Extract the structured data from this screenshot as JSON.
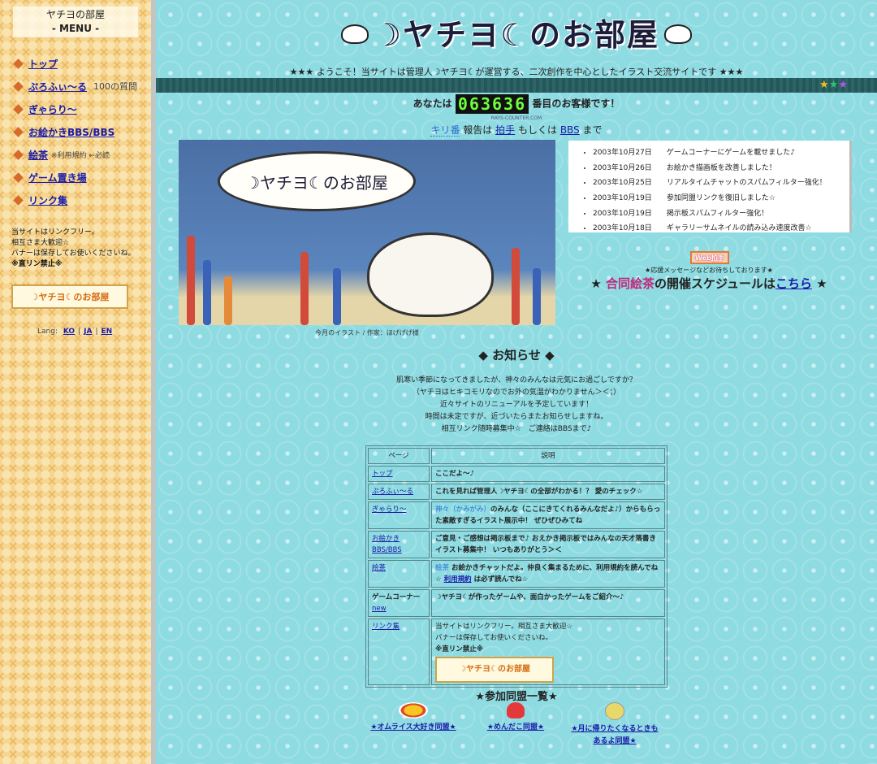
{
  "sidebar": {
    "site_name": "ヤチヨの部屋",
    "menu_label": "- MENU -",
    "items": [
      {
        "label": "トップ",
        "note": ""
      },
      {
        "label": "ぷろふぃ〜る",
        "note": "100の質問"
      },
      {
        "label": "ぎゃらり〜",
        "note": ""
      },
      {
        "label": "お絵かきBBS/BBS",
        "note": ""
      },
      {
        "label": "絵茶",
        "note": "※利用規約 ←必読"
      },
      {
        "label": "ゲーム置き場",
        "note": ""
      },
      {
        "label": "リンク集",
        "note": ""
      }
    ],
    "info_lines": [
      "当サイトはリンクフリー。",
      "相互さま大歓迎☆",
      "バナーは保存してお使いくださいね。",
      "※直リン禁止※"
    ],
    "banner_text": "☽ヤチヨ☾のお部屋",
    "lang_label": "Lang:",
    "lang_options": [
      "KO",
      "JA",
      "EN"
    ]
  },
  "header": {
    "title": "☽ヤチヨ☾のお部屋",
    "welcome": "★★★ ようこそ！当サイトは管理人☽ヤチヨ☾が運営する、二次創作を中心としたイラスト交流サイトです ★★★",
    "stars": "★★★"
  },
  "counter": {
    "prefix": "あなたは",
    "value": "063636",
    "suffix": "番目のお客様です！",
    "caption": "RAYS-COUNTER.COM",
    "kiriban": "キリ番",
    "report_text": "報告は",
    "link1": "拍手",
    "or_text": "もしくは",
    "link2": "BBS",
    "until": "まで"
  },
  "illustration": {
    "bubble_text": "☽ヤチヨ☾のお部屋",
    "caption": "今月のイラスト / 作家：ほげげげ様"
  },
  "news": [
    {
      "date": "2003年10月27日",
      "text": "ゲームコーナーにゲームを載せました♪"
    },
    {
      "date": "2003年10月26日",
      "text": "お絵かき描画板を改善しました！"
    },
    {
      "date": "2003年10月25日",
      "text": "リアルタイムチャットのスパムフィルター強化！"
    },
    {
      "date": "2003年10月19日",
      "text": "参加同盟リンクを復旧しました☆"
    },
    {
      "date": "2003年10月19日",
      "text": "掲示板スパムフィルター強化！"
    },
    {
      "date": "2003年10月18日",
      "text": "ギャラリーサムネイルの読み込み速度改善☆"
    }
  ],
  "web_clap": {
    "button": "Web拍手",
    "message": "★応援メッセージなどお待ちしております★"
  },
  "schedule": {
    "prefix": "★ ",
    "highlight": "合同絵茶",
    "middle": "の開催スケジュールは",
    "link": "こちら",
    "suffix": " ★"
  },
  "notice": {
    "title": "◆ お知らせ ◆",
    "lines": [
      "肌寒い季節になってきましたが、神々のみんなは元気にお過ごしですか？",
      "（ヤチヨはヒキコモリなのでお外の気温がわかりません＞＜；）",
      "近々サイトのリニューアルを予定しています！",
      "時間は未定ですが、近づいたらまたお知らせしますね。",
      "相互リンク随時募集中☆　ご連絡はBBSまで♪"
    ]
  },
  "pages_table": {
    "headers": [
      "ページ",
      "説明"
    ],
    "rows": [
      {
        "page": "トップ",
        "desc": "ここだよ〜♪"
      },
      {
        "page": "ぷろふぃ〜る",
        "desc": "これを見れば管理人☽ヤチヨ☾の全部がわかる！？ 愛のチェック☆"
      },
      {
        "page": "ぎゃらり〜",
        "desc_note": "神々（かみがみ）",
        "desc": "のみんな（ここにきてくれるみんなだよ♪）からもらった素敵すぎるイラスト展示中！ ぜひぜひみてね"
      },
      {
        "page": "お絵かきBBS/BBS",
        "desc": "ご意見・ご感想は掲示板まで♪ おえかき掲示板ではみんなの天才落書きイラスト募集中！ いつもありがとう＞＜"
      },
      {
        "page": "絵茶",
        "desc_note": "絵茶",
        "desc": " お絵かきチャットだよ。仲良く集まるために、利用規約を読んでね☆ ",
        "desc_link": "利用規約",
        "desc_end": " は必ず読んでね☆"
      },
      {
        "page": "ゲームコーナー",
        "page_new": "new",
        "desc": "☽ヤチヨ☾が作ったゲームや、面白かったゲームをご紹介〜♪"
      },
      {
        "page": "リンク集",
        "desc_lines": [
          "当サイトはリンクフリー。相互さま大歓迎☆",
          "バナーは保存してお使いくださいね。",
          "※直リン禁止※"
        ],
        "banner": "☽ヤチヨ☾のお部屋"
      }
    ]
  },
  "alliances": {
    "title": "★参加同盟一覧★",
    "items": [
      {
        "label": "★オムライス大好き同盟★",
        "icon": "omurice-icon"
      },
      {
        "label": "★めんだこ同盟★",
        "icon": "octopus-icon"
      },
      {
        "label": "★月に帰りたくなるときもあるよ同盟★",
        "icon": "moon-icon"
      }
    ]
  }
}
